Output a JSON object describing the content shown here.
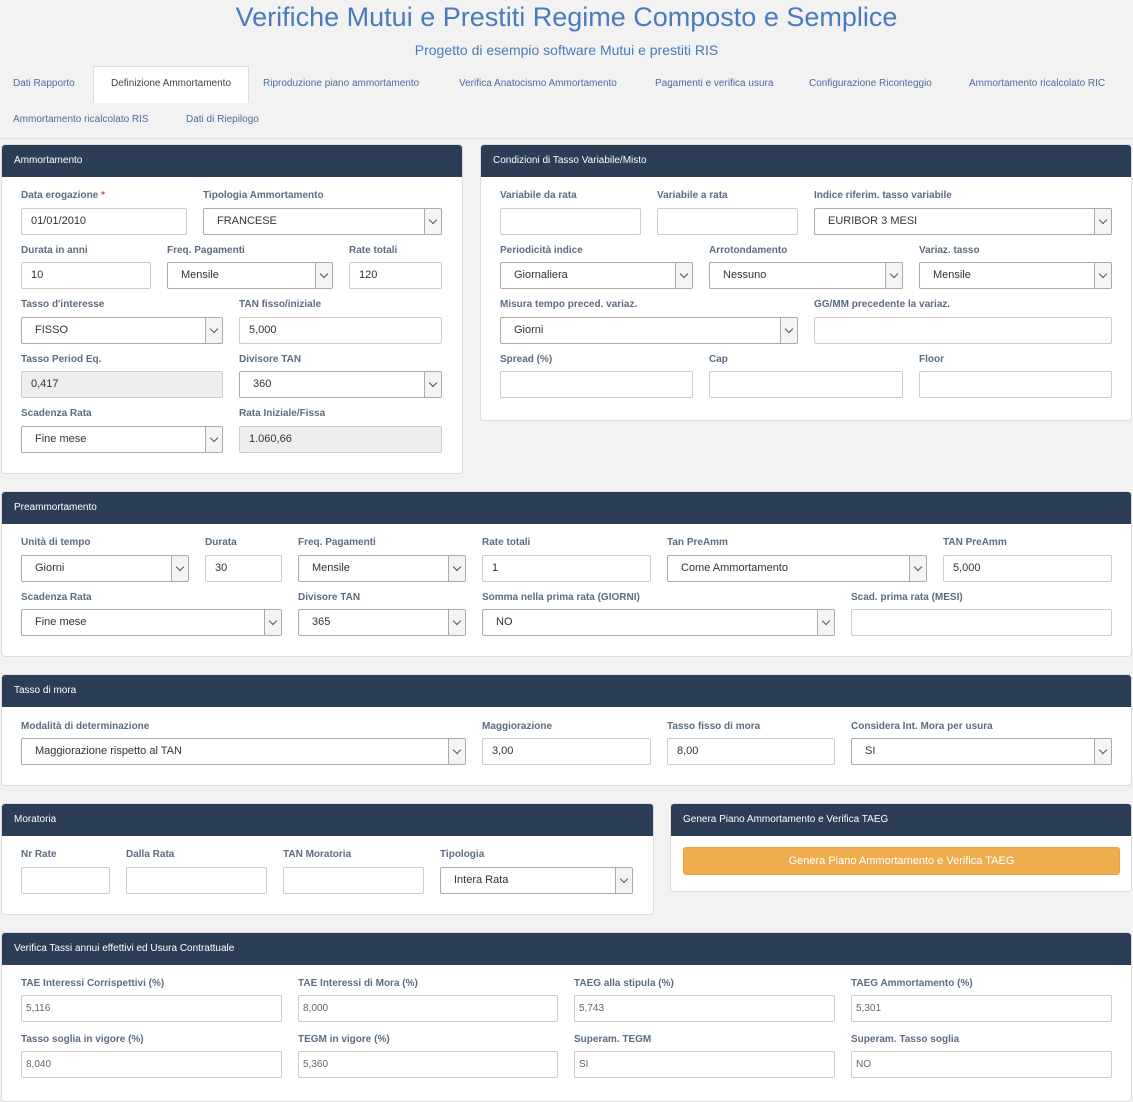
{
  "header": {
    "title": "Verifiche Mutui e Prestiti Regime Composto e Semplice",
    "subtitle": "Progetto di esempio software Mutui e prestiti RIS"
  },
  "tabs": [
    "Dati Rapporto",
    "Definizione Ammortamento",
    "Riproduzione piano ammortamento",
    "Verifica Anatocismo Ammortamento",
    "Pagamenti e verifica usura",
    "Configurazione Riconteggio",
    "Ammortamento ricalcolato RIC",
    "Ammortamento ricalcolato RIS",
    "Dati di Riepilogo"
  ],
  "active_tab": "Definizione Ammortamento",
  "ammortamento": {
    "title": "Ammortamento",
    "data_erogazione": {
      "label": "Data erogazione",
      "required": "*",
      "value": "01/01/2010"
    },
    "tipologia": {
      "label": "Tipologia Ammortamento",
      "value": "FRANCESE"
    },
    "durata": {
      "label": "Durata in anni",
      "value": "10"
    },
    "freq": {
      "label": "Freq. Pagamenti",
      "value": "Mensile"
    },
    "rate_totali": {
      "label": "Rate totali",
      "value": "120"
    },
    "tasso": {
      "label": "Tasso d'interesse",
      "value": "FISSO"
    },
    "tan": {
      "label": "TAN fisso/iniziale",
      "value": "5,000"
    },
    "tasso_period": {
      "label": "Tasso Period Eq.",
      "value": "0,417"
    },
    "divisore": {
      "label": "Divisore TAN",
      "value": "360"
    },
    "scadenza": {
      "label": "Scadenza Rata",
      "value": "Fine mese"
    },
    "rata": {
      "label": "Rata Iniziale/Fissa",
      "value": "1.060,66"
    }
  },
  "condizioni": {
    "title": "Condizioni di Tasso Variabile/Misto",
    "variabile_da": {
      "label": "Variabile da rata",
      "value": ""
    },
    "variabile_a": {
      "label": "Variabile a rata",
      "value": ""
    },
    "indice": {
      "label": "Indice riferim. tasso variabile",
      "value": "EURIBOR 3 MESI"
    },
    "periodicita": {
      "label": "Periodicità indice",
      "value": "Giornaliera"
    },
    "arrotondamento": {
      "label": "Arrotondamento",
      "value": "Nessuno"
    },
    "variaz": {
      "label": "Variaz. tasso",
      "value": "Mensile"
    },
    "misura": {
      "label": "Misura tempo preced. variaz.",
      "value": "Giorni"
    },
    "ggmm": {
      "label": "GG/MM precedente la variaz.",
      "value": ""
    },
    "spread": {
      "label": "Spread (%)",
      "value": ""
    },
    "cap": {
      "label": "Cap",
      "value": ""
    },
    "floor": {
      "label": "Floor",
      "value": ""
    }
  },
  "preammortamento": {
    "title": "Preammortamento",
    "unita": {
      "label": "Unità di tempo",
      "value": "Giorni"
    },
    "durata": {
      "label": "Durata",
      "value": "30"
    },
    "freq": {
      "label": "Freq. Pagamenti",
      "value": "Mensile"
    },
    "rate": {
      "label": "Rate totali",
      "value": "1"
    },
    "tan_preamm_sel": {
      "label": "Tan PreAmm",
      "value": "Come Ammortamento"
    },
    "tan_preamm": {
      "label": "TAN PreAmm",
      "value": "5,000"
    },
    "scadenza": {
      "label": "Scadenza Rata",
      "value": "Fine mese"
    },
    "divisore": {
      "label": "Divisore TAN",
      "value": "365"
    },
    "somma": {
      "label": "Somma nella prima rata (GIORNI)",
      "value": "NO"
    },
    "scad_prima": {
      "label": "Scad. prima rata (MESI)",
      "value": ""
    }
  },
  "mora": {
    "title": "Tasso di mora",
    "modalita": {
      "label": "Modalità di determinazione",
      "value": "Maggiorazione rispetto al TAN"
    },
    "maggiorazione": {
      "label": "Maggiorazione",
      "value": "3,00"
    },
    "tasso_fisso": {
      "label": "Tasso fisso di mora",
      "value": "8,00"
    },
    "considera": {
      "label": "Considera Int. Mora per usura",
      "value": "SI"
    }
  },
  "moratoria": {
    "title": "Moratoria",
    "nr_rate": {
      "label": "Nr Rate",
      "value": ""
    },
    "dalla": {
      "label": "Dalla Rata",
      "value": ""
    },
    "tan": {
      "label": "TAN Moratoria",
      "value": ""
    },
    "tipologia": {
      "label": "Tipologia",
      "value": "Intera Rata"
    }
  },
  "genera": {
    "title": "Genera Piano Ammortamento e Verifica TAEG",
    "button": "Genera Piano Ammortamento e Verifica TAEG"
  },
  "verifica": {
    "title": "Verifica Tassi annui effettivi ed Usura Contrattuale",
    "fields": [
      {
        "label": "TAE Interessi Corrispettivi (%)",
        "value": "5,116"
      },
      {
        "label": "TAE Interessi di Mora (%)",
        "value": "8,000"
      },
      {
        "label": "TAEG alla stipula (%)",
        "value": "5,743"
      },
      {
        "label": "TAEG Ammortamento (%)",
        "value": "5,301"
      },
      {
        "label": "Tasso soglia in vigore (%)",
        "value": "8,040"
      },
      {
        "label": "TEGM in vigore (%)",
        "value": "5,360"
      },
      {
        "label": "Superam. TEGM",
        "value": "SI"
      },
      {
        "label": "Superam. Tasso soglia",
        "value": "NO"
      }
    ]
  },
  "colors": {
    "panel_header": "#2b3e55",
    "accent": "#4a7ac0",
    "button": "#f0ad4e"
  }
}
